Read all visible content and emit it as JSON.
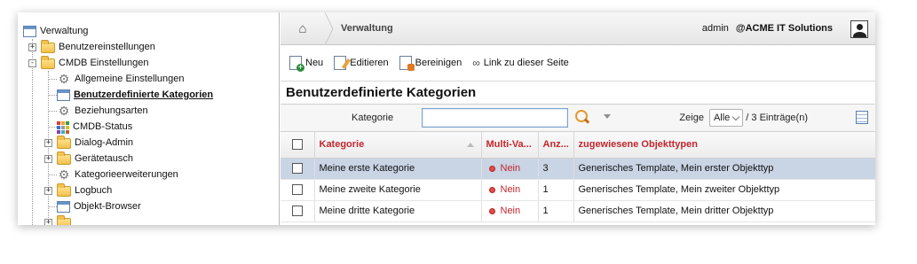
{
  "tree": {
    "root": {
      "label": "Verwaltung",
      "icon": "window-icon"
    },
    "items": [
      {
        "label": "Benutzereinstellungen",
        "icon": "folder-icon",
        "expander": "+"
      },
      {
        "label": "CMDB Einstellungen",
        "icon": "folder-open-icon",
        "expander": "-"
      },
      {
        "label": "Allgemeine Einstellungen",
        "icon": "gear-icon"
      },
      {
        "label": "Benutzerdefinierte Kategorien",
        "icon": "window-edit-icon",
        "active": true
      },
      {
        "label": "Beziehungsarten",
        "icon": "gear-icon"
      },
      {
        "label": "CMDB-Status",
        "icon": "color-grid-icon"
      },
      {
        "label": "Dialog-Admin",
        "icon": "folder-icon",
        "expander": "+"
      },
      {
        "label": "Gerätetausch",
        "icon": "folder-icon",
        "expander": "+"
      },
      {
        "label": "Kategorieerweiterungen",
        "icon": "gear-icon"
      },
      {
        "label": "Logbuch",
        "icon": "folder-icon",
        "expander": "+"
      },
      {
        "label": "Objekt-Browser",
        "icon": "window-icon"
      },
      {
        "label": "",
        "icon": "folder-icon",
        "expander": "+"
      }
    ]
  },
  "topbar": {
    "home_icon": "home-icon",
    "breadcrumb": "Verwaltung",
    "user": "admin",
    "tenant": "@ACME IT Solutions",
    "avatar_icon": "user-avatar-icon"
  },
  "toolbar": {
    "new_label": "Neu",
    "edit_label": "Editieren",
    "clean_label": "Bereinigen",
    "link_label": "Link zu dieser Seite"
  },
  "panel": {
    "title": "Benutzerdefinierte Kategorien"
  },
  "filter": {
    "label": "Kategorie",
    "value": "",
    "show_label": "Zeige",
    "show_selected": "Alle",
    "count_text": "/ 3 Einträge(n)"
  },
  "table": {
    "headers": [
      "Kategorie",
      "Multi-Va...",
      "Anz...",
      "zugewiesene Objekttypen"
    ],
    "rows": [
      {
        "kategorie": "Meine erste Kategorie",
        "multi": "Nein",
        "anzahl": "3",
        "objekttypen": "Generisches Template, Mein erster Objekttyp",
        "selected": true
      },
      {
        "kategorie": "Meine zweite Kategorie",
        "multi": "Nein",
        "anzahl": "1",
        "objekttypen": "Generisches Template, Mein zweiter Objekttyp",
        "selected": false
      },
      {
        "kategorie": "Meine dritte Kategorie",
        "multi": "Nein",
        "anzahl": "1",
        "objekttypen": "Generisches Template, Mein dritter Objekttyp",
        "selected": false
      }
    ]
  },
  "colors": {
    "header_text": "#c4262e",
    "selected_row": "#c9d4e4",
    "nein": "#c4262e"
  }
}
